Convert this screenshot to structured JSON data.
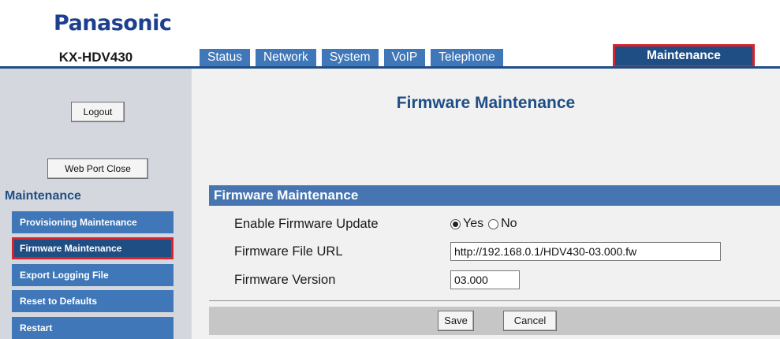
{
  "brand": "Panasonic",
  "model": "KX-HDV430",
  "tabs": [
    {
      "label": "Status"
    },
    {
      "label": "Network"
    },
    {
      "label": "System"
    },
    {
      "label": "VoIP"
    },
    {
      "label": "Telephone"
    },
    {
      "label": "Maintenance"
    }
  ],
  "active_tab": "Maintenance",
  "sidebar": {
    "logout_label": "Logout",
    "web_port_close_label": "Web Port Close",
    "heading": "Maintenance",
    "items": [
      {
        "label": "Provisioning Maintenance"
      },
      {
        "label": "Firmware Maintenance"
      },
      {
        "label": "Export Logging File"
      },
      {
        "label": "Reset to Defaults"
      },
      {
        "label": "Restart"
      }
    ],
    "selected_item": "Firmware Maintenance"
  },
  "main": {
    "page_title": "Firmware Maintenance",
    "section_title": "Firmware Maintenance",
    "fields": {
      "enable_update": {
        "label": "Enable Firmware Update",
        "options": [
          "Yes",
          "No"
        ],
        "selected": "Yes"
      },
      "file_url": {
        "label": "Firmware File URL",
        "value": "http://192.168.0.1/HDV430-03.000.fw"
      },
      "version": {
        "label": "Firmware Version",
        "value": "03.000"
      }
    },
    "save_label": "Save",
    "cancel_label": "Cancel"
  },
  "colors": {
    "brand_blue": "#1d3f8f",
    "tab_blue": "#3f77b8",
    "active_dark_blue": "#1f4e85",
    "highlight_red": "#d8242d"
  }
}
